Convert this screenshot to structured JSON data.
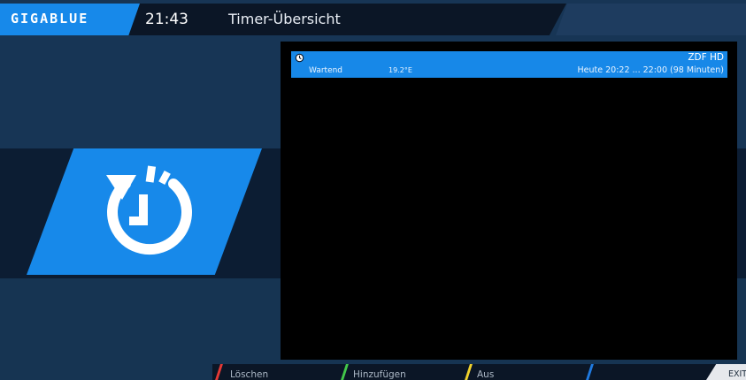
{
  "header": {
    "logo_text": "GIGABLUE",
    "clock": "21:43",
    "title": "Timer-Übersicht"
  },
  "timer_list": {
    "rows": [
      {
        "icon": "clock-icon",
        "channel": "ZDF HD",
        "status": "Wartend",
        "satellite": "19.2°E",
        "time": "Heute 20:22 ... 22:00 (98 Minuten)",
        "selected": true
      }
    ]
  },
  "footer": {
    "red": "Löschen",
    "green": "Hinzufügen",
    "yellow": "Aus",
    "blue": "",
    "exit": "EXIT"
  },
  "colors": {
    "accent": "#1789ea",
    "red": "#e53935",
    "green": "#43c84a",
    "yellow": "#f2d22b",
    "blue": "#1f7ae0"
  }
}
